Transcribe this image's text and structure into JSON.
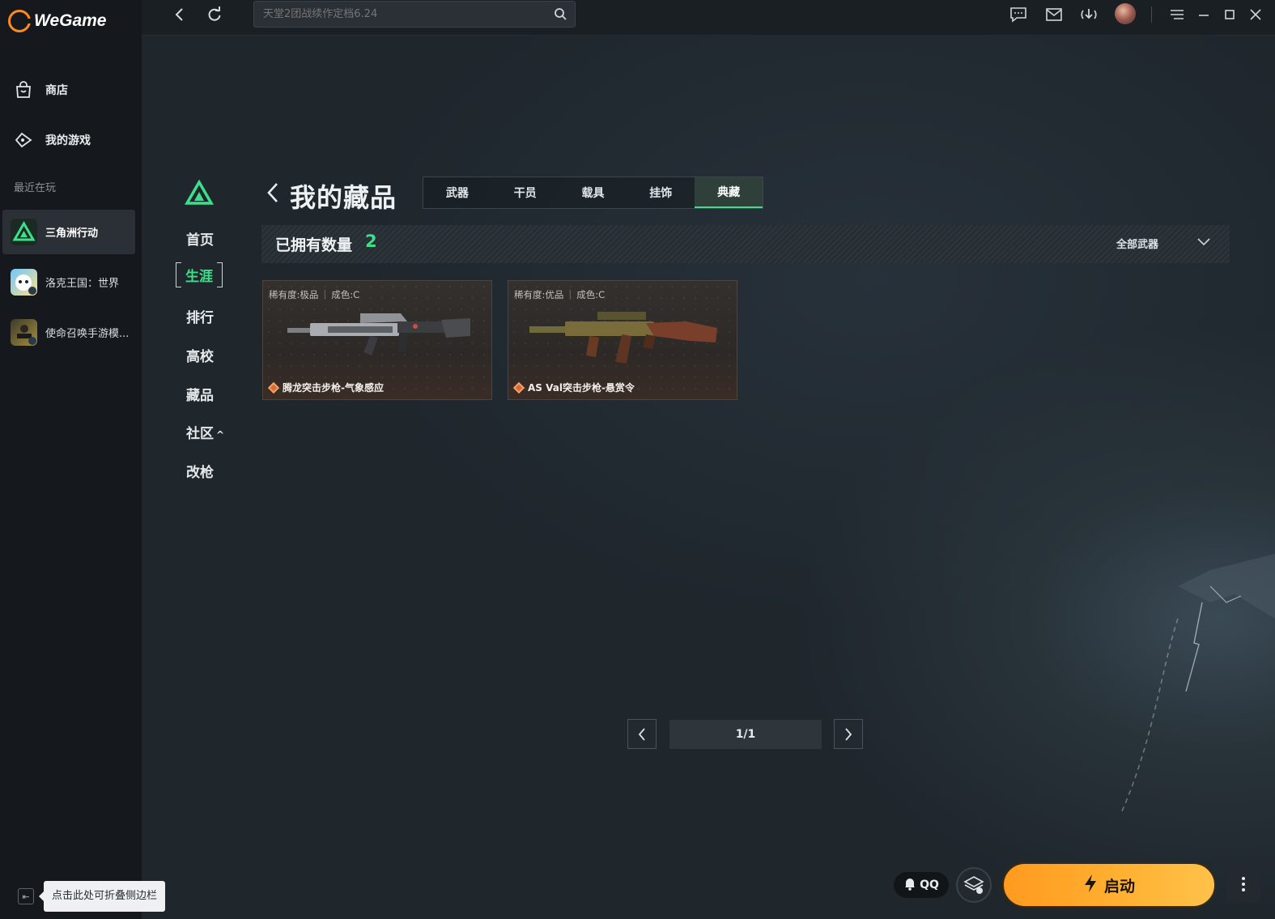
{
  "app": {
    "name": "WeGame"
  },
  "sidebar": {
    "store": "商店",
    "my_games": "我的游戏",
    "recent_label": "最近在玩",
    "games": [
      {
        "name": "三角洲行动"
      },
      {
        "name": "洛克王国：世界"
      },
      {
        "name": "使命召唤手游模..."
      }
    ],
    "collapse_icon": "⇤",
    "tooltip": "点击此处可折叠侧边栏"
  },
  "topbar": {
    "search_placeholder": "天堂2团战续作定档6.24",
    "icons": [
      "back-icon",
      "refresh-icon",
      "search-icon",
      "chat-icon",
      "mail-icon",
      "download-icon",
      "avatar",
      "menu-icon",
      "minimize-icon",
      "maximize-icon",
      "close-icon"
    ]
  },
  "game_nav": {
    "items": [
      "首页",
      "生涯",
      "排行",
      "高校",
      "藏品",
      "社区",
      "改枪"
    ],
    "active": "生涯",
    "community_caret": "^"
  },
  "page": {
    "title": "我的藏品",
    "tabs": [
      "武器",
      "干员",
      "载具",
      "挂饰",
      "典藏"
    ],
    "active_tab": "典藏",
    "owned_label": "已拥有数量",
    "owned_count": "2",
    "filter": "全部武器"
  },
  "items": [
    {
      "rarity": "稀有度:极品",
      "condition": "成色:C",
      "name": "腾龙突击步枪-气象感应"
    },
    {
      "rarity": "稀有度:优品",
      "condition": "成色:C",
      "name": "AS Val突击步枪-悬赏令"
    }
  ],
  "pagination": {
    "label": "1/1"
  },
  "bottom": {
    "qq": "QQ",
    "launch": "启动"
  },
  "colors": {
    "accent": "#3de08a",
    "launch": "#ffb233",
    "rarity_diamond": "#d86a36"
  }
}
